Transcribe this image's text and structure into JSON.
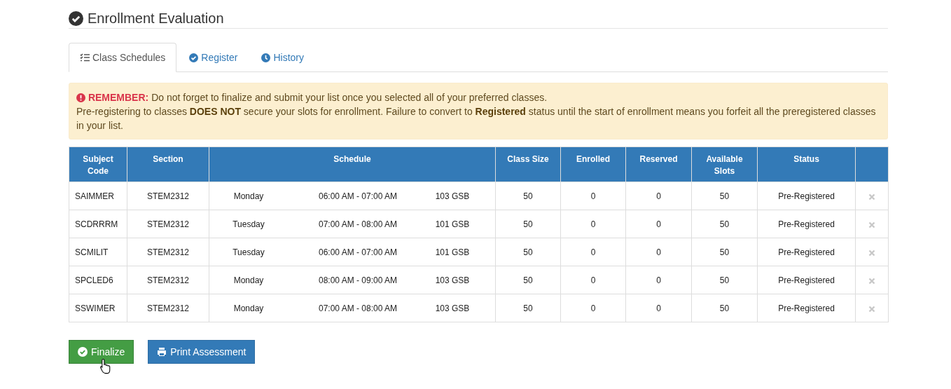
{
  "page_title": "Enrollment Evaluation",
  "tabs": [
    {
      "label": "Class Schedules",
      "kind": "list",
      "selected": true
    },
    {
      "label": "Register",
      "kind": "check",
      "selected": false
    },
    {
      "label": "History",
      "kind": "clock",
      "selected": false
    }
  ],
  "alert": {
    "label": "REMEMBER:",
    "lines": [
      "Do not forget to finalize and submit your list once you selected all of your preferred classes.",
      "Pre-registering to classes **DOES NOT** secure your slots for enrollment. Failure to convert to **Registered** status until the start of enrollment means you forfeit all the preregistered classes in your list."
    ]
  },
  "table": {
    "columns": [
      "Subject Code",
      "Section",
      "Schedule",
      "Class Size",
      "Enrolled",
      "Reserved",
      "Available Slots",
      "Status"
    ],
    "rows": [
      {
        "subject_code": "SAIMMER",
        "section": "STEM2312",
        "day": "Monday",
        "time": "06:00 AM - 07:00 AM",
        "room": "103 GSB",
        "class_size": "50",
        "enrolled": "0",
        "reserved": "0",
        "available_slots": "50",
        "status": "Pre-Registered"
      },
      {
        "subject_code": "SCDRRRM",
        "section": "STEM2312",
        "day": "Tuesday",
        "time": "07:00 AM - 08:00 AM",
        "room": "101 GSB",
        "class_size": "50",
        "enrolled": "0",
        "reserved": "0",
        "available_slots": "50",
        "status": "Pre-Registered"
      },
      {
        "subject_code": "SCMILIT",
        "section": "STEM2312",
        "day": "Tuesday",
        "time": "06:00 AM - 07:00 AM",
        "room": "101 GSB",
        "class_size": "50",
        "enrolled": "0",
        "reserved": "0",
        "available_slots": "50",
        "status": "Pre-Registered"
      },
      {
        "subject_code": "SPCLED6",
        "section": "STEM2312",
        "day": "Monday",
        "time": "08:00 AM - 09:00 AM",
        "room": "103 GSB",
        "class_size": "50",
        "enrolled": "0",
        "reserved": "0",
        "available_slots": "50",
        "status": "Pre-Registered"
      },
      {
        "subject_code": "SSWIMER",
        "section": "STEM2312",
        "day": "Monday",
        "time": "07:00 AM - 08:00 AM",
        "room": "103 GSB",
        "class_size": "50",
        "enrolled": "0",
        "reserved": "0",
        "available_slots": "50",
        "status": "Pre-Registered"
      }
    ]
  },
  "buttons": [
    {
      "label": "Finalize",
      "kind": "success"
    },
    {
      "label": "Print Assessment",
      "kind": "primary"
    }
  ]
}
